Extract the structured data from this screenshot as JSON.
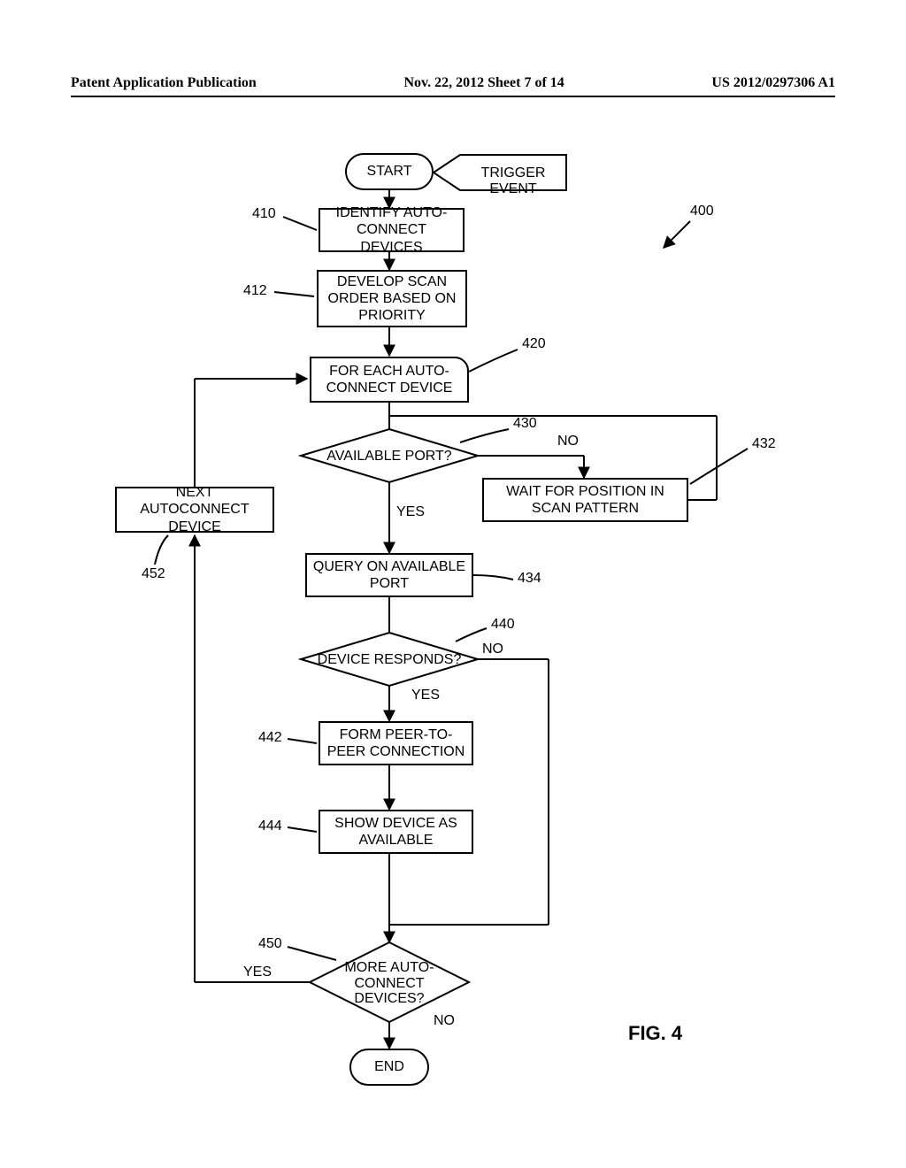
{
  "header": {
    "left": "Patent Application Publication",
    "center": "Nov. 22, 2012  Sheet 7 of 14",
    "right": "US 2012/0297306 A1"
  },
  "figure_label": "FIG. 4",
  "refs": {
    "r400": "400",
    "r410": "410",
    "r412": "412",
    "r420": "420",
    "r430": "430",
    "r432": "432",
    "r434": "434",
    "r440": "440",
    "r442": "442",
    "r444": "444",
    "r450": "450",
    "r452": "452"
  },
  "nodes": {
    "start": "START",
    "trigger": "TRIGGER EVENT",
    "identify": "IDENTIFY AUTO-CONNECT DEVICES",
    "develop": "DEVELOP SCAN ORDER BASED ON PRIORITY",
    "foreach": "FOR EACH AUTO-CONNECT DEVICE",
    "avail_port": "AVAILABLE PORT?",
    "wait_pos": "WAIT FOR POSITION IN SCAN PATTERN",
    "next_device": "NEXT AUTOCONNECT DEVICE",
    "query": "QUERY ON AVAILABLE PORT",
    "responds": "DEVICE RESPONDS?",
    "form_p2p": "FORM PEER-TO-PEER CONNECTION",
    "show_avail": "SHOW DEVICE AS AVAILABLE",
    "more_devices": "MORE AUTO-CONNECT DEVICES?",
    "end": "END"
  },
  "edges": {
    "yes": "YES",
    "no": "NO"
  },
  "chart_data": {
    "type": "flowchart",
    "title": "FIG. 4",
    "reference_number": 400,
    "nodes": [
      {
        "id": "start",
        "type": "terminator",
        "text": "START"
      },
      {
        "id": "trigger",
        "type": "off-page",
        "text": "TRIGGER EVENT",
        "points_to": "start"
      },
      {
        "id": 410,
        "type": "process",
        "text": "IDENTIFY AUTO-CONNECT DEVICES"
      },
      {
        "id": 412,
        "type": "process",
        "text": "DEVELOP SCAN ORDER BASED ON PRIORITY"
      },
      {
        "id": 420,
        "type": "loop-header",
        "text": "FOR EACH AUTO-CONNECT DEVICE"
      },
      {
        "id": 430,
        "type": "decision",
        "text": "AVAILABLE PORT?"
      },
      {
        "id": 432,
        "type": "process",
        "text": "WAIT FOR POSITION IN SCAN PATTERN"
      },
      {
        "id": 434,
        "type": "process",
        "text": "QUERY ON AVAILABLE PORT"
      },
      {
        "id": 440,
        "type": "decision",
        "text": "DEVICE RESPONDS?"
      },
      {
        "id": 442,
        "type": "process",
        "text": "FORM PEER-TO-PEER CONNECTION"
      },
      {
        "id": 444,
        "type": "process",
        "text": "SHOW DEVICE AS AVAILABLE"
      },
      {
        "id": 450,
        "type": "decision",
        "text": "MORE AUTO-CONNECT DEVICES?"
      },
      {
        "id": 452,
        "type": "process",
        "text": "NEXT AUTOCONNECT DEVICE"
      },
      {
        "id": "end",
        "type": "terminator",
        "text": "END"
      }
    ],
    "edges": [
      {
        "from": "start",
        "to": 410
      },
      {
        "from": 410,
        "to": 412
      },
      {
        "from": 412,
        "to": 420
      },
      {
        "from": 420,
        "to": 430
      },
      {
        "from": 430,
        "to": 434,
        "label": "YES"
      },
      {
        "from": 430,
        "to": 432,
        "label": "NO"
      },
      {
        "from": 432,
        "to": 430,
        "note": "loop back"
      },
      {
        "from": 434,
        "to": 440
      },
      {
        "from": 440,
        "to": 442,
        "label": "YES"
      },
      {
        "from": 440,
        "to": 450,
        "label": "NO",
        "note": "routes to join"
      },
      {
        "from": 442,
        "to": 444
      },
      {
        "from": 444,
        "to": 450
      },
      {
        "from": 450,
        "to": "end",
        "label": "NO"
      },
      {
        "from": 450,
        "to": 452,
        "label": "YES"
      },
      {
        "from": 452,
        "to": 420,
        "note": "loop back to FOR EACH"
      }
    ]
  }
}
